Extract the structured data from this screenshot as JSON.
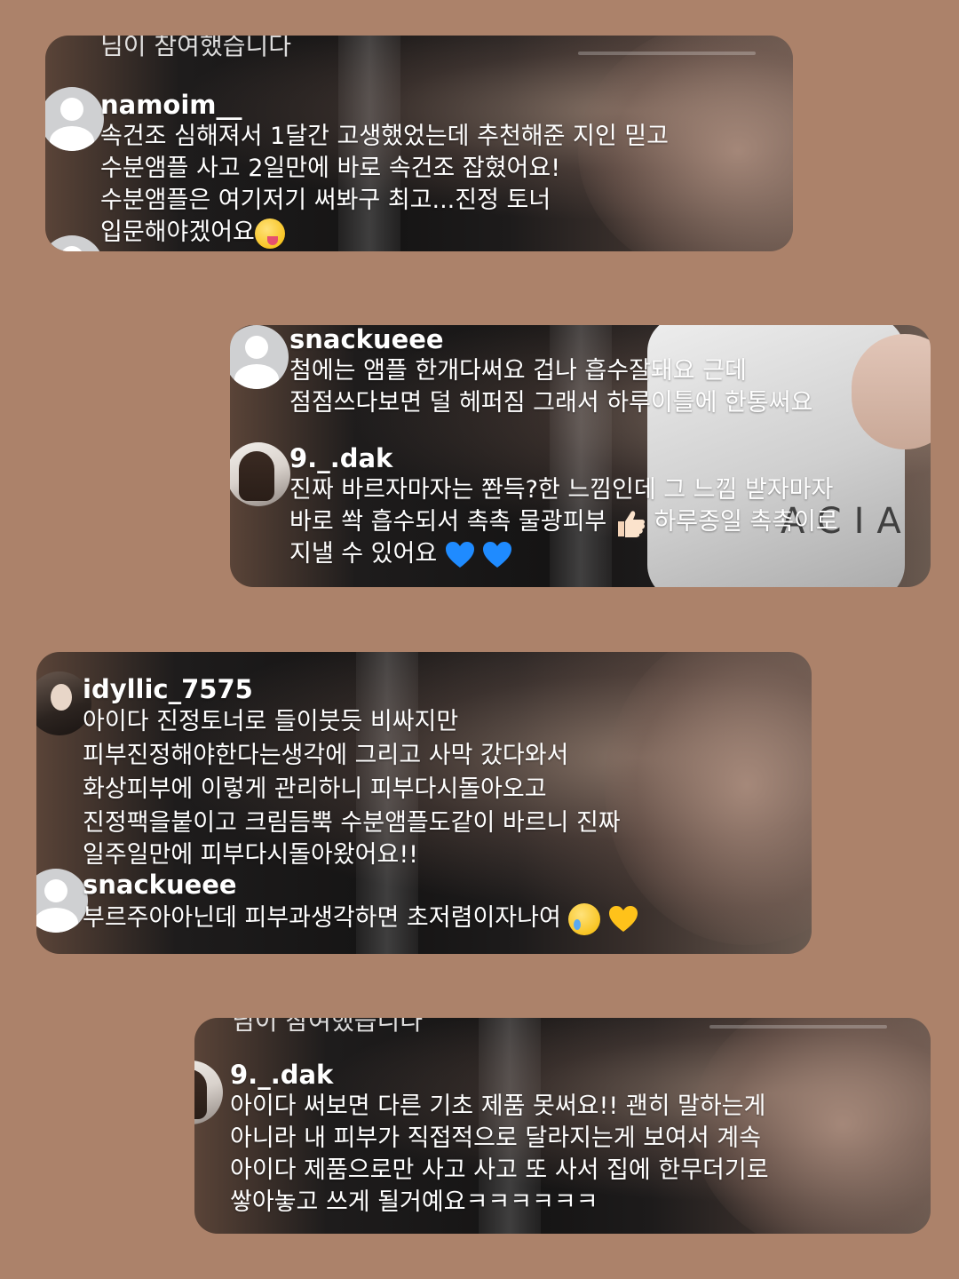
{
  "cards": [
    {
      "top_clip": "님이 참여했습니다",
      "comments": [
        {
          "username": "namoim__",
          "lines": [
            "속건조 심해져서 1달간 고생했었는데 추천해준 지인 믿고",
            "수분앰플 사고 2일만에 바로 속건조 잡혔어요!",
            "수분앰플은 여기저기 써봐구 최고...진정 토너",
            "입문해야겠어요"
          ],
          "emoji": "face-with-tongue"
        }
      ]
    },
    {
      "comments": [
        {
          "username": "snackueee",
          "lines": [
            "첨에는 앰플 한개다써요 겁나 흡수잘돼요 근데",
            "점점쓰다보면 덜 헤퍼짐 그래서 하루이틀에 한통써요"
          ]
        },
        {
          "username": "9._.dak",
          "lines": [
            "진짜 바르자마자는 쫜득?한 느낌인데 그 느낌 받자마자",
            "바로 쏵 흡수되서 촉촉 물광피부",
            "하루종일 촉촉이로",
            "지낼 수 있어요"
          ],
          "emoji": [
            "thumbs-up",
            "blue-heart",
            "blue-heart"
          ]
        }
      ],
      "brand": "ACIA"
    },
    {
      "comments": [
        {
          "username": "idyllic_7575",
          "lines": [
            "아이다 진정토너로 들이붓듯 비싸지만",
            "피부진정해야한다는생각에 그리고 사막 갔다와서",
            "화상피부에 이렇게 관리하니 피부다시돌아오고",
            "진정팩을붙이고 크림듬뿍 수분앰플도같이 바르니 진짜",
            "일주일만에 피부다시돌아왔어요!!"
          ]
        },
        {
          "username": "snackueee",
          "lines": [
            "부르주아아닌데 피부과생각하면 초저렴이자나여"
          ],
          "emoji": [
            "crying-face",
            "yellow-heart"
          ]
        }
      ]
    },
    {
      "top_clip": "님이 참여했습니다",
      "comments": [
        {
          "username": "9._.dak",
          "lines": [
            "아이다 써보면 다른 기초 제품 못써요!! 괜히 말하는게",
            "아니라 내 피부가 직접적으로 달라지는게 보여서 계속",
            "아이다 제품으로만 사고 사고 또 사서 집에 한무더기로",
            "쌓아놓고 쓰게 될거예요ㅋㅋㅋㅋㅋㅋ"
          ]
        }
      ]
    }
  ],
  "colors": {
    "background": "#ac826a",
    "text": "#ffffff",
    "avatar_placeholder": "#cfd0d2",
    "blue_heart": "#1f8bff",
    "yellow_heart": "#ffc21a"
  }
}
